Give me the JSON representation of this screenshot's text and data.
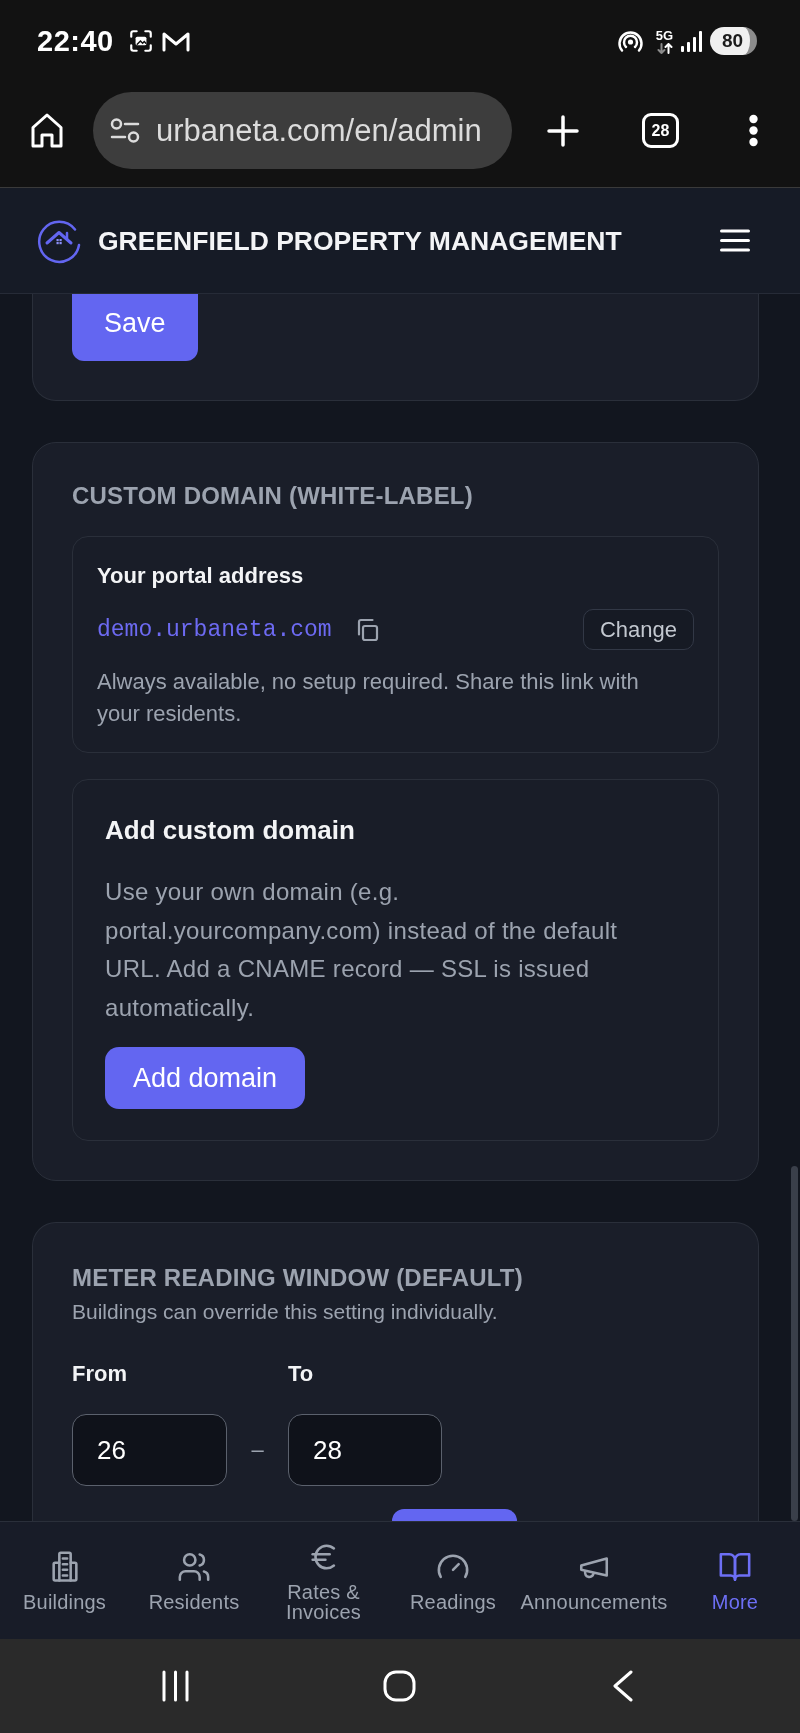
{
  "status_bar": {
    "time": "22:40",
    "network": "5G",
    "battery": "80"
  },
  "browser": {
    "url": "urbaneta.com/en/admin",
    "tab_count": "28"
  },
  "app_header": {
    "title": "GREENFIELD PROPERTY MANAGEMENT"
  },
  "save_card": {
    "button": "Save"
  },
  "custom_domain": {
    "title": "CUSTOM DOMAIN (WHITE-LABEL)",
    "portal": {
      "label": "Your portal address",
      "address": "demo.urbaneta.com",
      "change_button": "Change",
      "note": "Always available, no setup required. Share this link with your residents."
    },
    "add_domain": {
      "title": "Add custom domain",
      "description": "Use your own domain (e.g. portal.yourcompany.com) instead of the default URL. Add a CNAME record — SSL is issued automatically.",
      "button": "Add domain"
    }
  },
  "meter_window": {
    "title": "METER READING WINDOW (DEFAULT)",
    "subtitle": "Buildings can override this setting individually.",
    "fields": [
      {
        "label": "From",
        "value": "26"
      },
      {
        "label": "To",
        "value": "28"
      }
    ],
    "separator": "–"
  },
  "bottom_nav": [
    {
      "label": "Buildings",
      "selected": false
    },
    {
      "label": "Residents",
      "selected": false
    },
    {
      "label": "Rates & Invoices",
      "selected": false
    },
    {
      "label": "Readings",
      "selected": false
    },
    {
      "label": "Announcements",
      "selected": false
    },
    {
      "label": "More",
      "selected": true
    }
  ]
}
